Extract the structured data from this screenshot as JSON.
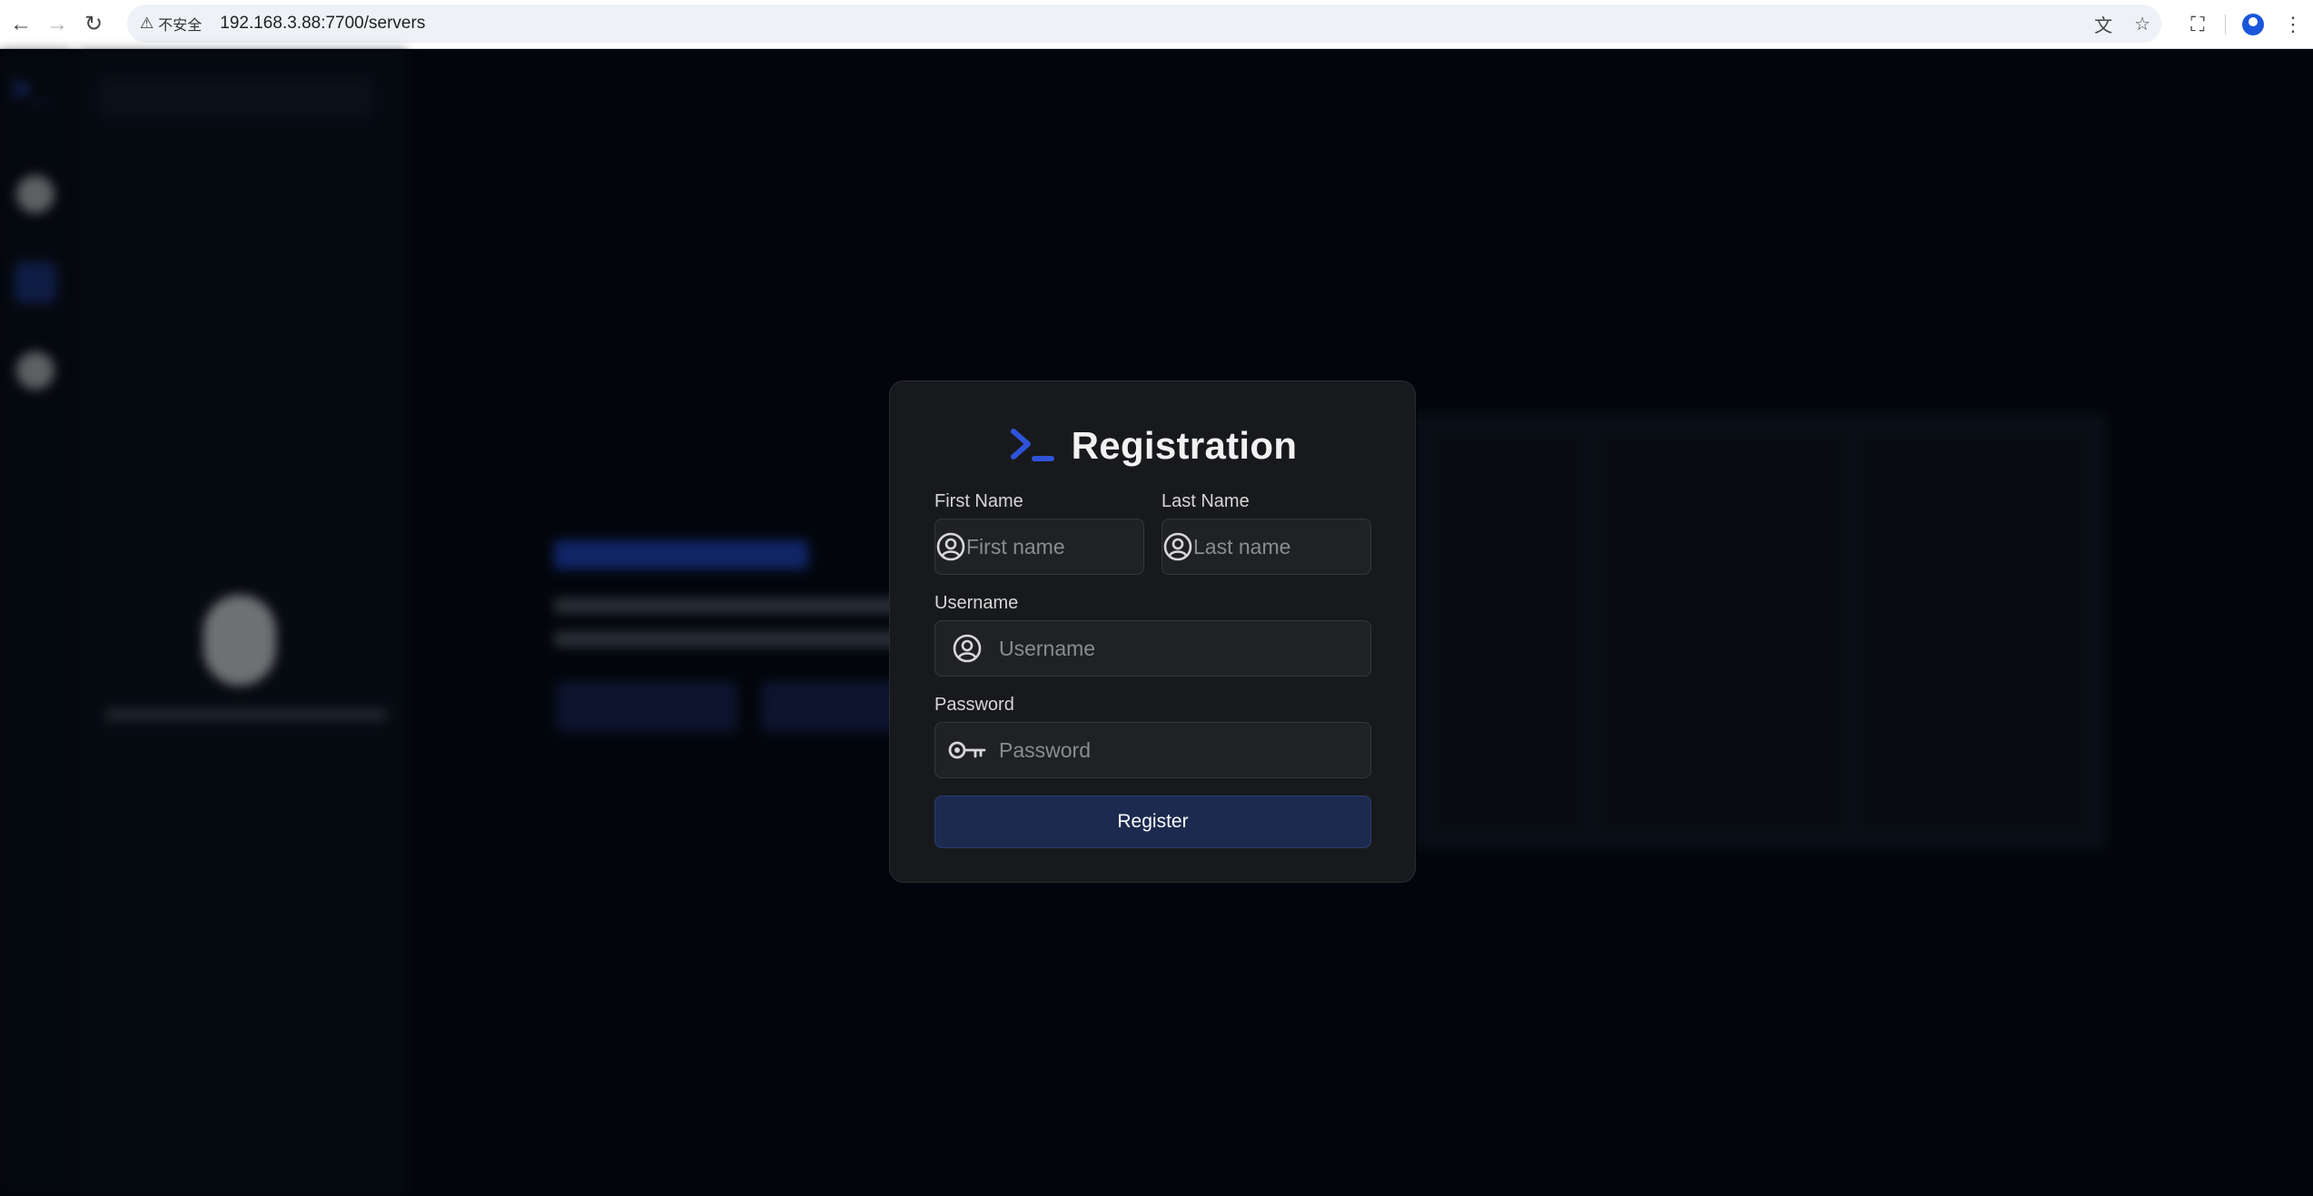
{
  "browser": {
    "security_label": "不安全",
    "url": "192.168.3.88:7700/servers",
    "icons": {
      "back": "back-arrow-icon",
      "forward": "forward-arrow-icon",
      "reload": "reload-icon",
      "warning": "warning-icon",
      "translate": "translate-icon",
      "bookmark": "star-icon",
      "extensions": "extensions-icon",
      "profile": "profile-icon",
      "menu": "kebab-menu-icon"
    }
  },
  "dialog": {
    "title": "Registration",
    "logo_color": "#2f53d9",
    "fields": {
      "first_name": {
        "label": "First Name",
        "placeholder": "First name",
        "value": ""
      },
      "last_name": {
        "label": "Last Name",
        "placeholder": "Last name",
        "value": ""
      },
      "username": {
        "label": "Username",
        "placeholder": "Username",
        "value": ""
      },
      "password": {
        "label": "Password",
        "placeholder": "Password",
        "value": ""
      }
    },
    "submit_label": "Register"
  },
  "colors": {
    "accent": "#2f53d9",
    "button_bg": "#1c2a4f",
    "dialog_bg": "#18191c",
    "page_bg": "#02060c"
  }
}
